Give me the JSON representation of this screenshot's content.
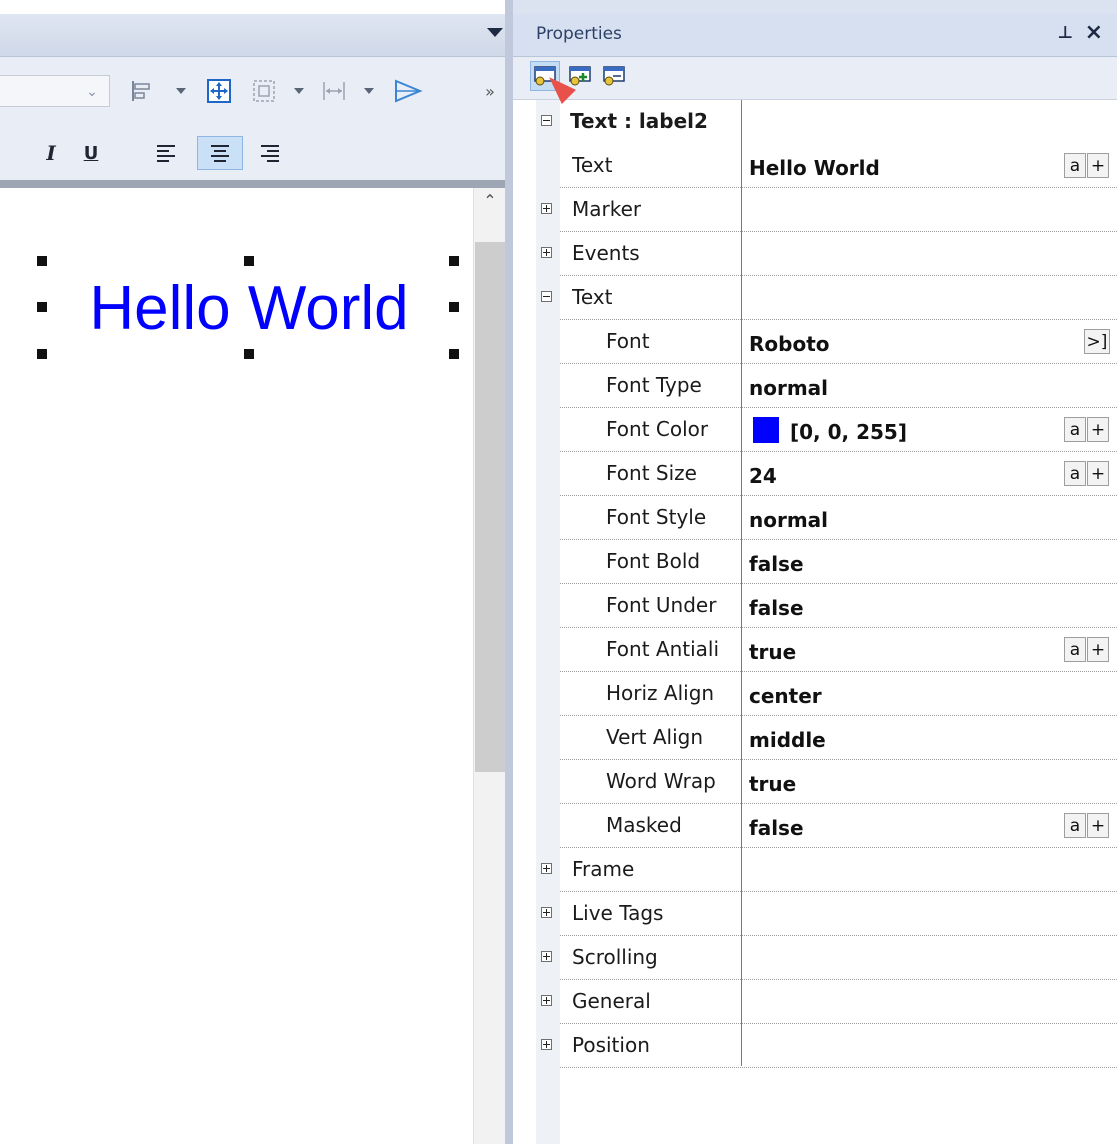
{
  "designer": {
    "label_text": "Hello World",
    "label_color": "#0000ff",
    "toolbar_overflow": "»"
  },
  "properties": {
    "title": "Properties",
    "pin_glyph": "ᵖ",
    "close_glyph": "×",
    "header_row": "Text : label2",
    "rows": [
      {
        "name": "Text",
        "value": "Hello World",
        "buttons": [
          "a",
          "+"
        ]
      },
      {
        "name": "Marker",
        "value": "",
        "group": true
      },
      {
        "name": "Events",
        "value": "",
        "group": true
      },
      {
        "name": "Text",
        "value": "",
        "group": true,
        "expanded": true
      },
      {
        "name": "Font",
        "value": "Roboto",
        "buttons": [
          ">]"
        ]
      },
      {
        "name": "Font Type",
        "value": "normal"
      },
      {
        "name": "Font Color",
        "value": "[0, 0, 255]",
        "swatch": "#0000ff",
        "buttons": [
          "a",
          "+"
        ]
      },
      {
        "name": "Font Size",
        "value": "24",
        "buttons": [
          "a",
          "+"
        ]
      },
      {
        "name": "Font Style",
        "value": "normal"
      },
      {
        "name": "Font Bold",
        "value": "false"
      },
      {
        "name": "Font Under",
        "value": "false"
      },
      {
        "name": "Font Antiali",
        "value": "true",
        "buttons": [
          "a",
          "+"
        ]
      },
      {
        "name": "Horiz Align",
        "value": "center"
      },
      {
        "name": "Vert Align",
        "value": "middle"
      },
      {
        "name": "Word Wrap",
        "value": "true"
      },
      {
        "name": "Masked",
        "value": "false",
        "buttons": [
          "a",
          "+"
        ]
      },
      {
        "name": "Frame",
        "value": "",
        "group": true
      },
      {
        "name": "Live Tags",
        "value": "",
        "group": true
      },
      {
        "name": "Scrolling",
        "value": "",
        "group": true
      },
      {
        "name": "General",
        "value": "",
        "group": true
      },
      {
        "name": "Position",
        "value": "",
        "group": true
      }
    ]
  },
  "colors": {
    "selection_blue": "#c9e0f7",
    "panel_header": "#d6e0f0"
  }
}
